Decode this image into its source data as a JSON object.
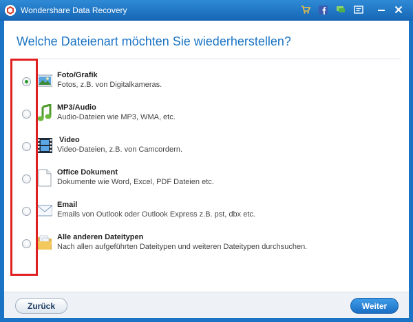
{
  "window": {
    "title": "Wondershare Data Recovery"
  },
  "titlebar_icons": [
    "cart-icon",
    "facebook-icon",
    "feedback-icon",
    "register-icon",
    "minimize-icon",
    "close-icon"
  ],
  "heading": "Welche Dateienart möchten Sie wiederherstellen?",
  "options": [
    {
      "title": "Foto/Grafik",
      "desc": "Fotos, z.B. von Digitalkameras.",
      "icon": "photo-icon",
      "checked": true
    },
    {
      "title": "MP3/Audio",
      "desc": "Audio-Dateien wie MP3, WMA, etc.",
      "icon": "music-note-icon",
      "checked": false
    },
    {
      "title": "Video",
      "desc": "Video-Dateien, z.B. von Camcordern.",
      "icon": "film-strip-icon",
      "checked": false
    },
    {
      "title": "Office Dokument",
      "desc": "Dokumente wie Word, Excel, PDF Dateien etc.",
      "icon": "document-icon",
      "checked": false
    },
    {
      "title": "Email",
      "desc": "Emails von Outlook oder Outlook Express z.B. pst, dbx etc.",
      "icon": "envelope-icon",
      "checked": false
    },
    {
      "title": "Alle anderen Dateitypen",
      "desc": "Nach allen aufgeführten Dateitypen und weiteren Dateitypen durchsuchen.",
      "icon": "folder-icon",
      "checked": false
    }
  ],
  "footer": {
    "back_label": "Zurück",
    "next_label": "Weiter"
  },
  "colors": {
    "accent": "#1a73c4",
    "highlight": "#e02020",
    "selected_radio": "#2b9a2b"
  }
}
